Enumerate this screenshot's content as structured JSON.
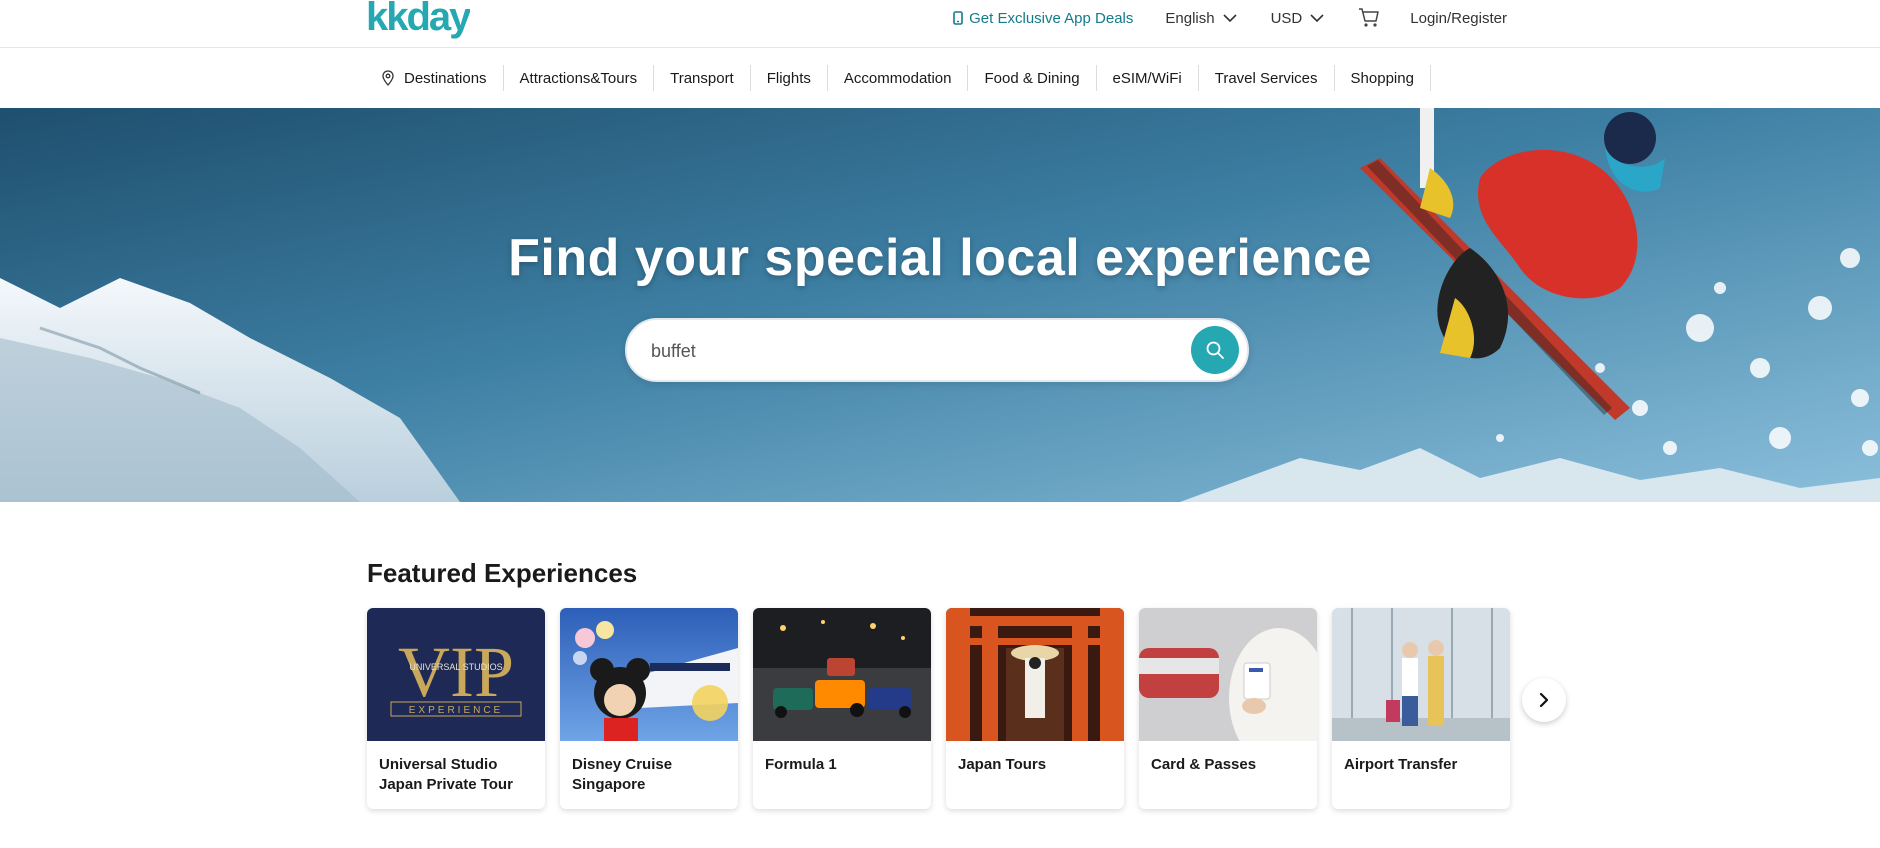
{
  "header": {
    "logo_text": "kkday",
    "app_deals": "Get Exclusive App Deals",
    "language": "English",
    "currency": "USD",
    "login": "Login/Register"
  },
  "nav": {
    "items": [
      {
        "label": "Destinations"
      },
      {
        "label": "Attractions&Tours"
      },
      {
        "label": "Transport"
      },
      {
        "label": "Flights"
      },
      {
        "label": "Accommodation"
      },
      {
        "label": "Food & Dining"
      },
      {
        "label": "eSIM/WiFi"
      },
      {
        "label": "Travel Services"
      },
      {
        "label": "Shopping"
      }
    ]
  },
  "hero": {
    "title": "Find your special local experience",
    "search_value": "buffet"
  },
  "featured": {
    "title": "Featured Experiences",
    "cards": [
      {
        "label": "Universal Studio Japan Private Tour"
      },
      {
        "label": "Disney Cruise Singapore"
      },
      {
        "label": "Formula 1"
      },
      {
        "label": "Japan Tours"
      },
      {
        "label": "Card & Passes"
      },
      {
        "label": "Airport Transfer"
      }
    ]
  },
  "colors": {
    "brand": "#25a8b1",
    "app_deals_text": "#137b8a"
  },
  "icons": {
    "location": "location-pin-icon",
    "phone": "phone-icon",
    "chevron": "chevron-down-icon",
    "cart": "cart-icon",
    "search": "search-icon",
    "next": "chevron-right-icon"
  }
}
